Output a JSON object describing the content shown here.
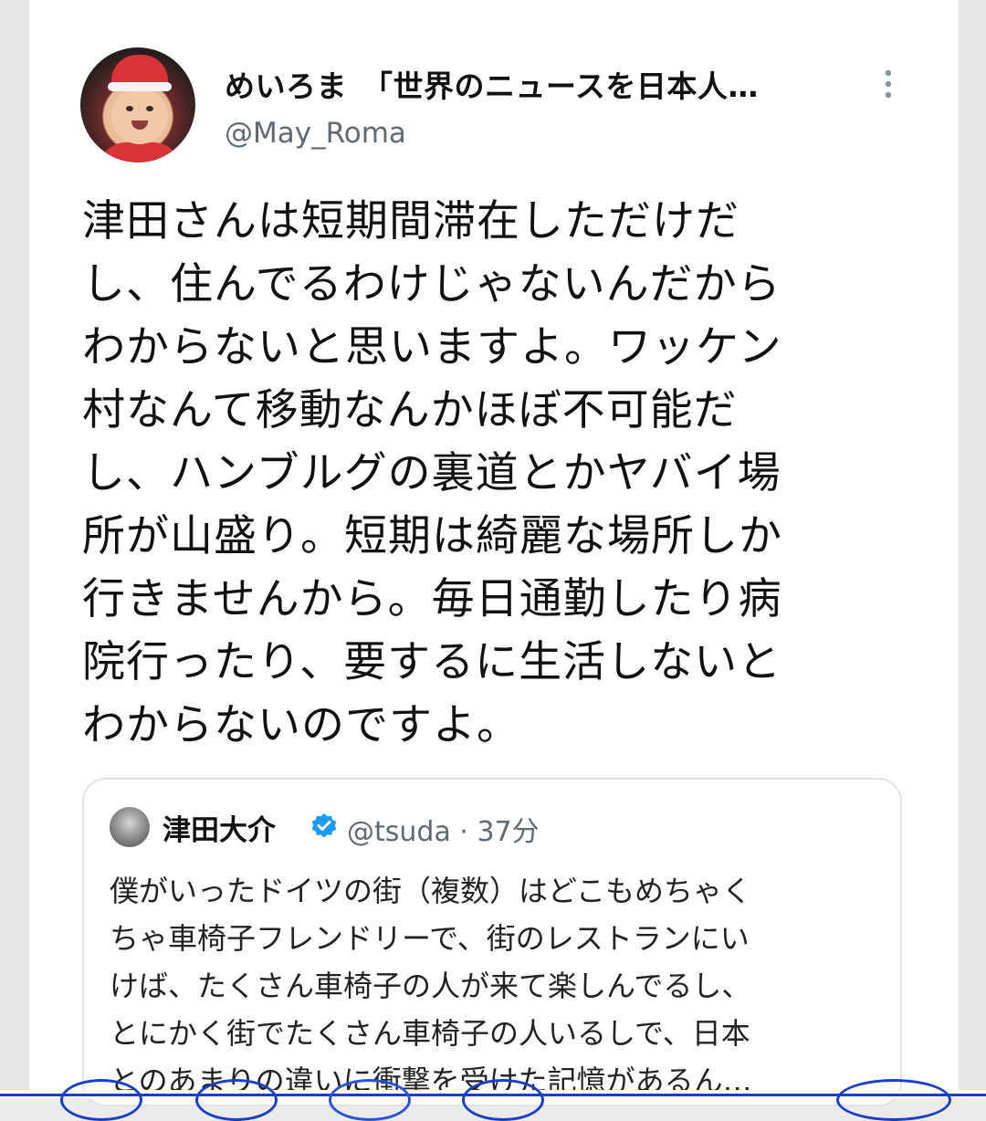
{
  "tweet": {
    "display_name": "めいろま　「世界のニュースを日本人…",
    "handle": "@May_Roma",
    "lines": [
      "津田さんは短期間滞在しただけだ",
      "し、住んでるわけじゃないんだから",
      "わからないと思いますよ。ワッケン",
      "村なんて移動なんかほぼ不可能だ",
      "し、ハンブルグの裏道とかヤバイ場",
      "所が山盛り。短期は綺麗な場所しか",
      "行きませんから。毎日通勤したり病",
      "院行ったり、要するに生活しないと",
      "わからないのですよ。"
    ]
  },
  "quoted_tweet": {
    "name": "津田大介",
    "handle_time": "@tsuda · 37分",
    "lines": [
      "僕がいったドイツの街（複数）はどこもめちゃく",
      "ちゃ車椅子フレンドリーで、街のレストランにい",
      "けば、たくさん車椅子の人が来て楽しんでるし、",
      "とにかく街でたくさん車椅子の人いるしで、日本",
      "とのあまりの違いに衝撃を受けた記憶があるん…"
    ]
  },
  "icons": {
    "more": "more-vertical-icon",
    "verified": "verified-badge-icon"
  },
  "colors": {
    "accent": "#1d9bf0",
    "secondary_text": "#5f6a73",
    "bottom_line": "#1a3fc6"
  }
}
